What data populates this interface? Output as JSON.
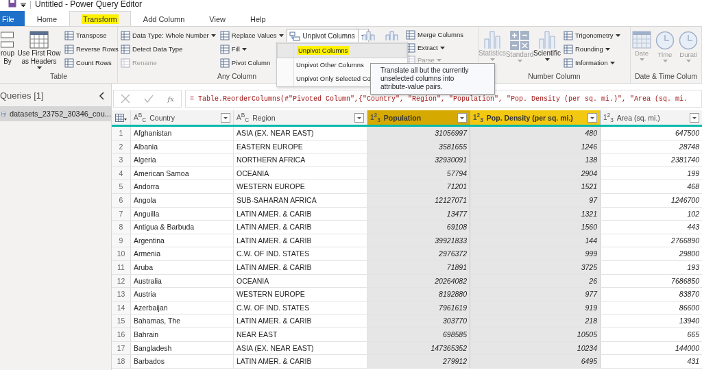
{
  "window": {
    "title": "Untitled - Power Query Editor"
  },
  "tabs": [
    {
      "label": "File",
      "kind": "file",
      "selected": false,
      "highlighted": false
    },
    {
      "label": "Home",
      "kind": "tab",
      "selected": false,
      "highlighted": false
    },
    {
      "label": "Transform",
      "kind": "tab",
      "selected": true,
      "highlighted": true
    },
    {
      "label": "Add Column",
      "kind": "tab",
      "selected": false,
      "highlighted": false
    },
    {
      "label": "View",
      "kind": "tab",
      "selected": false,
      "highlighted": false
    },
    {
      "label": "Help",
      "kind": "tab",
      "selected": false,
      "highlighted": false
    }
  ],
  "ribbon": {
    "groups": [
      {
        "label": "Table",
        "columns": [
          {
            "kind": "large",
            "label": "roup By",
            "menu": false,
            "disabled": false
          },
          {
            "kind": "large",
            "label": "Use First Row as Headers",
            "menu": true,
            "disabled": false
          },
          {
            "kind": "stack",
            "items": [
              {
                "label": "Transpose",
                "menu": false,
                "disabled": false
              },
              {
                "label": "Reverse Rows",
                "menu": false,
                "disabled": false
              },
              {
                "label": "Count Rows",
                "menu": false,
                "disabled": false
              }
            ]
          }
        ]
      },
      {
        "label": "Any Column",
        "columns": [
          {
            "kind": "stack",
            "items": [
              {
                "label": "Data Type: Whole Number",
                "menu": true,
                "disabled": false
              },
              {
                "label": "Detect Data Type",
                "menu": false,
                "disabled": false
              },
              {
                "label": "Rename",
                "menu": false,
                "disabled": true
              }
            ]
          },
          {
            "kind": "stack",
            "items": [
              {
                "label": "Replace Values",
                "menu": true,
                "disabled": false
              },
              {
                "label": "Fill",
                "menu": true,
                "disabled": false
              },
              {
                "label": "Pivot Column",
                "menu": false,
                "disabled": false
              }
            ]
          },
          {
            "kind": "split",
            "label": "Unpivot Columns",
            "expanded": true
          }
        ]
      },
      {
        "columns": [
          {
            "kind": "large",
            "menu": false,
            "disabled": false
          },
          {
            "kind": "large",
            "menu": false,
            "disabled": false
          },
          {
            "kind": "stack",
            "items": [
              {
                "label": "Merge Columns",
                "menu": false,
                "disabled": false
              },
              {
                "label": "Extract",
                "menu": true,
                "disabled": false
              },
              {
                "label": "Parse",
                "menu": true,
                "disabled": true
              }
            ]
          }
        ]
      },
      {
        "label": "Number Column",
        "columns": [
          {
            "kind": "large",
            "label": "Statistics",
            "menu": true,
            "disabled": true
          },
          {
            "kind": "large",
            "label": "Standard",
            "menu": true,
            "disabled": true
          },
          {
            "kind": "large",
            "label": "Scientific",
            "menu": true,
            "disabled": false
          },
          {
            "kind": "stack",
            "items": [
              {
                "label": "Trigonometry",
                "menu": true,
                "disabled": false
              },
              {
                "label": "Rounding",
                "menu": true,
                "disabled": false
              },
              {
                "label": "Information",
                "menu": true,
                "disabled": false
              }
            ]
          }
        ]
      },
      {
        "label": "Date & Time Colum",
        "columns": [
          {
            "kind": "large",
            "label": "Date",
            "menu": true,
            "disabled": true
          },
          {
            "kind": "large",
            "label": "Time",
            "menu": true,
            "disabled": true
          },
          {
            "kind": "large",
            "label": "Durati",
            "menu": true,
            "disabled": true
          }
        ]
      }
    ]
  },
  "unpivot_menu": {
    "items": [
      {
        "label": "Unpivot Columns",
        "selected": true,
        "highlighted": true
      },
      {
        "label": "Unpivot Other Columns",
        "selected": false,
        "highlighted": false
      },
      {
        "label": "Unpivot Only Selected Co",
        "selected": false,
        "highlighted": false
      }
    ]
  },
  "tooltip": "Translate all but the currently unselected columns into attribute-value pairs.",
  "queries": {
    "title": "Queries [1]",
    "items": [
      {
        "label": "datasets_23752_30346_cou...",
        "selected": true
      }
    ]
  },
  "formula_bar": {
    "fx": "fx",
    "formula": "= Table.ReorderColumns(#\"Pivoted Column\",{\"Country\", \"Region\", \"Population\", \"Pop. Density (per sq. mi.)\", \"Area (sq. mi."
  },
  "table": {
    "columns": [
      {
        "type": "A$^{B}$$_{C}$",
        "label": "Country",
        "selected": false,
        "focused": false
      },
      {
        "type": "A$^{B}$$_{C}$",
        "label": "Region",
        "selected": false,
        "focused": false
      },
      {
        "type": "1$^{2}$$_{3}$",
        "label": "Population",
        "selected": true,
        "focused": true
      },
      {
        "type": "1$^{2}$$_{3}$",
        "label": "Pop. Density (per sq. mi.)",
        "selected": true,
        "focused": false
      },
      {
        "type": "1$^{2}$$_{3}$",
        "label": "Area (sq. mi.)",
        "selected": false,
        "focused": false
      }
    ],
    "rows": [
      {
        "n": "1",
        "cells": [
          "Afghanistan",
          "ASIA (EX. NEAR EAST)",
          "31056997",
          "480",
          "647500"
        ]
      },
      {
        "n": "2",
        "cells": [
          "Albania",
          "EASTERN EUROPE",
          "3581655",
          "1246",
          "28748"
        ]
      },
      {
        "n": "3",
        "cells": [
          "Algeria",
          "NORTHERN AFRICA",
          "32930091",
          "138",
          "2381740"
        ]
      },
      {
        "n": "4",
        "cells": [
          "American Samoa",
          "OCEANIA",
          "57794",
          "2904",
          "199"
        ]
      },
      {
        "n": "5",
        "cells": [
          "Andorra",
          "WESTERN EUROPE",
          "71201",
          "1521",
          "468"
        ]
      },
      {
        "n": "6",
        "cells": [
          "Angola",
          "SUB-SAHARAN AFRICA",
          "12127071",
          "97",
          "1246700"
        ]
      },
      {
        "n": "7",
        "cells": [
          "Anguilla",
          "LATIN AMER. & CARIB",
          "13477",
          "1321",
          "102"
        ]
      },
      {
        "n": "8",
        "cells": [
          "Antigua & Barbuda",
          "LATIN AMER. & CARIB",
          "69108",
          "1560",
          "443"
        ]
      },
      {
        "n": "9",
        "cells": [
          "Argentina",
          "LATIN AMER. & CARIB",
          "39921833",
          "144",
          "2766890"
        ]
      },
      {
        "n": "10",
        "cells": [
          "Armenia",
          "C.W. OF IND. STATES",
          "2976372",
          "999",
          "29800"
        ]
      },
      {
        "n": "11",
        "cells": [
          "Aruba",
          "LATIN AMER. & CARIB",
          "71891",
          "3725",
          "193"
        ]
      },
      {
        "n": "12",
        "cells": [
          "Australia",
          "OCEANIA",
          "20264082",
          "26",
          "7686850"
        ]
      },
      {
        "n": "13",
        "cells": [
          "Austria",
          "WESTERN EUROPE",
          "8192880",
          "977",
          "83870"
        ]
      },
      {
        "n": "14",
        "cells": [
          "Azerbaijan",
          "C.W. OF IND. STATES",
          "7961619",
          "919",
          "86600"
        ]
      },
      {
        "n": "15",
        "cells": [
          "Bahamas, The",
          "LATIN AMER. & CARIB",
          "303770",
          "218",
          "13940"
        ]
      },
      {
        "n": "16",
        "cells": [
          "Bahrain",
          "NEAR EAST",
          "698585",
          "10505",
          "665"
        ]
      },
      {
        "n": "17",
        "cells": [
          "Bangladesh",
          "ASIA (EX. NEAR EAST)",
          "147365352",
          "10234",
          "144000"
        ]
      },
      {
        "n": "18",
        "cells": [
          "Barbados",
          "LATIN AMER. & CARIB",
          "279912",
          "6495",
          "431"
        ]
      }
    ]
  }
}
